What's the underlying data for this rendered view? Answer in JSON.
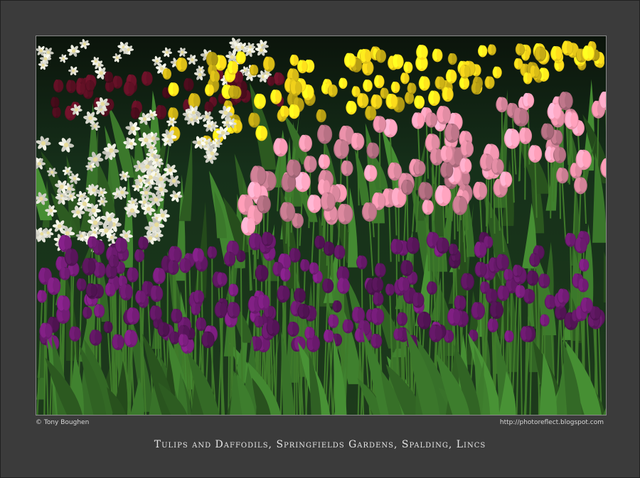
{
  "photo": {
    "description_icon": "tulip-field-photo",
    "colors": {
      "background": "#3b3b3b",
      "purple_tulips": "#6b1a6e",
      "pink_tulips": "#e890a8",
      "yellow_tulips": "#f2d21a",
      "white_daffodils": "#f2f2e6",
      "maroon_tulips": "#5a0f22",
      "foliage": "#2f5a24"
    }
  },
  "credits": {
    "copyright": "© Tony Boughen",
    "url": "http://photoreflect.blogspot.com"
  },
  "caption": "Tulips and Daffodils, Springfields Gardens, Spalding, Lincs"
}
